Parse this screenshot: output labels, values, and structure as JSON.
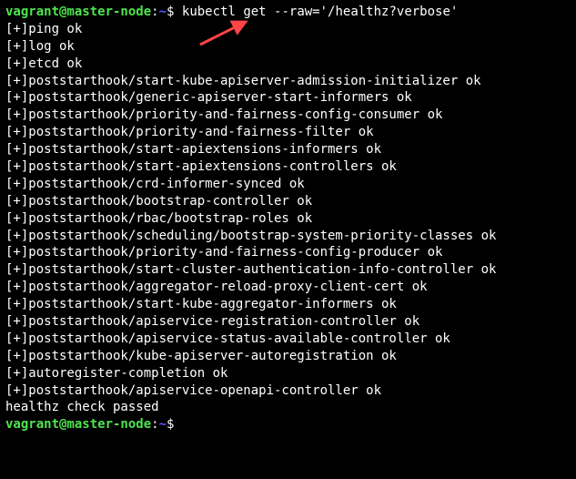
{
  "prompt": {
    "user_host": "vagrant@master-node",
    "colon": ":",
    "path": "~",
    "dollar": "$ "
  },
  "command": "kubectl get --raw='/healthz?verbose'",
  "arrow_color": "#ff4545",
  "output_lines": [
    "[+]ping ok",
    "[+]log ok",
    "[+]etcd ok",
    "[+]poststarthook/start-kube-apiserver-admission-initializer ok",
    "[+]poststarthook/generic-apiserver-start-informers ok",
    "[+]poststarthook/priority-and-fairness-config-consumer ok",
    "[+]poststarthook/priority-and-fairness-filter ok",
    "[+]poststarthook/start-apiextensions-informers ok",
    "[+]poststarthook/start-apiextensions-controllers ok",
    "[+]poststarthook/crd-informer-synced ok",
    "[+]poststarthook/bootstrap-controller ok",
    "[+]poststarthook/rbac/bootstrap-roles ok",
    "[+]poststarthook/scheduling/bootstrap-system-priority-classes ok",
    "[+]poststarthook/priority-and-fairness-config-producer ok",
    "[+]poststarthook/start-cluster-authentication-info-controller ok",
    "[+]poststarthook/aggregator-reload-proxy-client-cert ok",
    "[+]poststarthook/start-kube-aggregator-informers ok",
    "[+]poststarthook/apiservice-registration-controller ok",
    "[+]poststarthook/apiservice-status-available-controller ok",
    "[+]poststarthook/kube-apiserver-autoregistration ok",
    "[+]autoregister-completion ok",
    "[+]poststarthook/apiservice-openapi-controller ok",
    "healthz check passed"
  ]
}
